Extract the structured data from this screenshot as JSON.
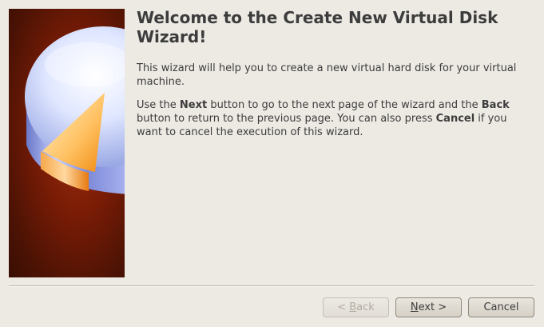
{
  "wizard": {
    "title": "Welcome to the Create New Virtual Disk Wizard!",
    "intro": "This wizard will help you to create a new virtual hard disk for your virtual machine.",
    "instructions": {
      "part1": "Use the ",
      "next": "Next",
      "part2": " button to go to the next page of the wizard and the ",
      "back": "Back",
      "part3": " button to return to the previous page. You can also press ",
      "cancel": "Cancel",
      "part4": " if you want to cancel the execution of this wizard."
    }
  },
  "buttons": {
    "back": {
      "prefix": "< ",
      "mnemonic": "B",
      "rest": "ack",
      "enabled": false
    },
    "next": {
      "mnemonic": "N",
      "rest": "ext >",
      "enabled": true
    },
    "cancel": {
      "label": "Cancel",
      "enabled": true
    }
  },
  "colors": {
    "background": "#edeae4",
    "banner_dark": "#4a1204",
    "banner_mid": "#a3300f",
    "disk_top": "#dfe8ff",
    "pie_slice": "#f8a020"
  },
  "icons": {
    "banner": "disk-pie-chart-icon"
  }
}
